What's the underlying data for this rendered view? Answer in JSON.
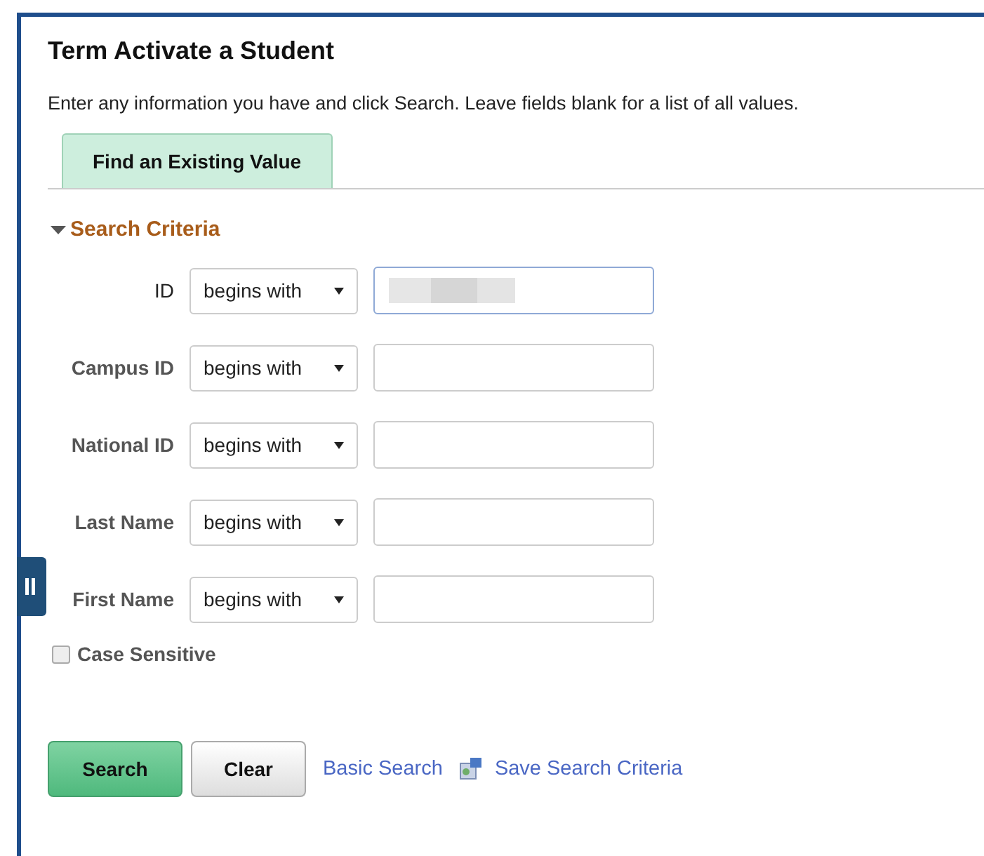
{
  "page": {
    "title": "Term Activate a Student",
    "instructions": "Enter any information you have and click Search. Leave fields blank for a list of all values."
  },
  "tabs": [
    {
      "label": "Find an Existing Value",
      "selected": true
    }
  ],
  "section": {
    "title": "Search Criteria",
    "expanded": true
  },
  "fields": [
    {
      "label": "ID",
      "operator": "begins with",
      "focused": true,
      "redacted": true
    },
    {
      "label": "Campus ID",
      "operator": "begins with",
      "focused": false,
      "redacted": false
    },
    {
      "label": "National ID",
      "operator": "begins with",
      "focused": false,
      "redacted": false
    },
    {
      "label": "Last Name",
      "operator": "begins with",
      "focused": false,
      "redacted": false
    },
    {
      "label": "First Name",
      "operator": "begins with",
      "focused": false,
      "redacted": false
    }
  ],
  "case_sensitive": {
    "label": "Case Sensitive",
    "checked": false
  },
  "buttons": [
    {
      "label": "Search",
      "kind": "primary"
    },
    {
      "label": "Clear",
      "kind": "secondary"
    }
  ],
  "links": [
    {
      "label": "Basic Search",
      "icon": false
    },
    {
      "label": "Save Search Criteria",
      "icon": true
    }
  ]
}
